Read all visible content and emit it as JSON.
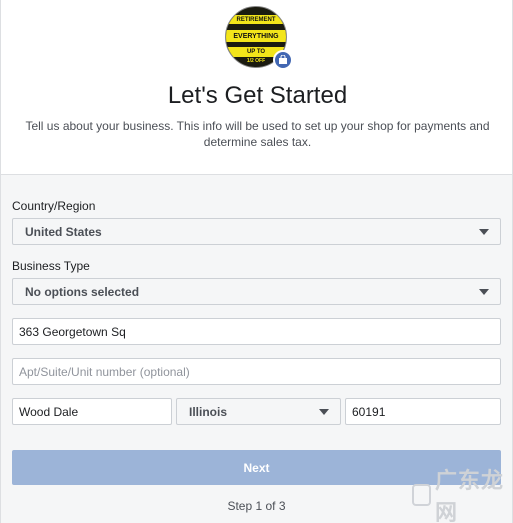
{
  "header": {
    "logo_lines": [
      "RETIREMENT",
      "EVERYTHING",
      "UP TO",
      "1/2 OFF"
    ],
    "title": "Let's Get Started",
    "description": "Tell us about your business. This info will be used to set up your shop for payments and determine sales tax."
  },
  "form": {
    "country_label": "Country/Region",
    "country_value": "United States",
    "business_type_label": "Business Type",
    "business_type_value": "No options selected",
    "street_value": "363 Georgetown Sq",
    "apt_placeholder": "Apt/Suite/Unit number (optional)",
    "city_value": "Wood Dale",
    "state_value": "Illinois",
    "zip_value": "60191"
  },
  "footer": {
    "next_label": "Next",
    "step_text": "Step 1 of 3"
  },
  "watermark": {
    "text": "广东龙网"
  },
  "colors": {
    "accent": "#4267b2",
    "next_disabled": "#9cb4d8",
    "form_bg": "#f5f6f7"
  }
}
